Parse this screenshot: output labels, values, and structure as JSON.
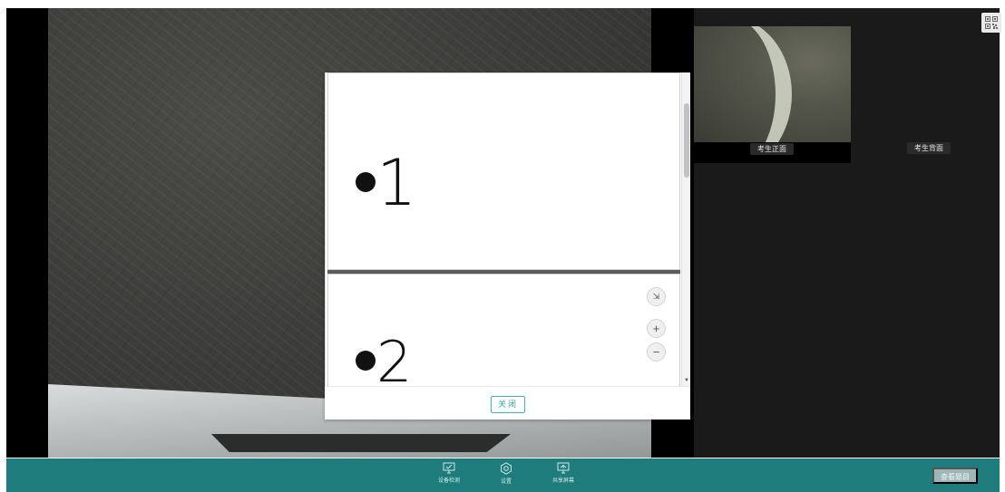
{
  "camera": {
    "front_label": "考生正面",
    "back_label": "考生背面"
  },
  "qr_icon": "qr-code-icon",
  "document_viewer": {
    "pages": [
      {
        "text": "1"
      },
      {
        "text": "2"
      }
    ],
    "tools": {
      "fit": "⇲",
      "zoom_in": "+",
      "zoom_out": "−"
    },
    "close_label": "关闭"
  },
  "toolbar": {
    "items": [
      {
        "label": "设备检测",
        "icon": "monitor-check-icon"
      },
      {
        "label": "设置",
        "icon": "gear-icon"
      },
      {
        "label": "共享屏幕",
        "icon": "screen-share-icon"
      }
    ],
    "view_button": "查看题目"
  },
  "colors": {
    "toolbar_bg": "#1e7c7c",
    "accent": "#2ba8a3"
  }
}
